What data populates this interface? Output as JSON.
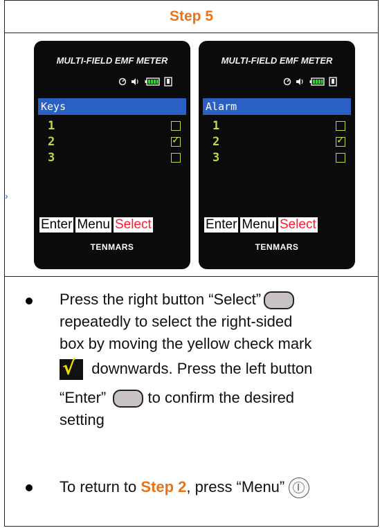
{
  "header": {
    "title": "Step 5"
  },
  "screens": [
    {
      "title": "MULTI-FIELD EMF METER",
      "menu_label": "Keys",
      "items": [
        {
          "label": "1",
          "checked": false
        },
        {
          "label": "2",
          "checked": true
        },
        {
          "label": "3",
          "checked": false
        }
      ],
      "buttons": {
        "enter": "Enter",
        "menu": "Menu",
        "select": "Select"
      },
      "brand": "TENMARS"
    },
    {
      "title": "MULTI-FIELD EMF METER",
      "menu_label": "Alarm",
      "items": [
        {
          "label": "1",
          "checked": false
        },
        {
          "label": "2",
          "checked": true
        },
        {
          "label": "3",
          "checked": false
        }
      ],
      "buttons": {
        "enter": "Enter",
        "menu": "Menu",
        "select": "Select"
      },
      "brand": "TENMARS"
    }
  ],
  "instructions": {
    "p1_part1": "Press the right button “Select”",
    "p1_line2": "repeatedly to select the right-sided",
    "p1_line3": "box by moving the yellow check mark",
    "p1_part4": "downwards. Press the left button",
    "p1_part5a": "“Enter”",
    "p1_part5b": "to confirm the desired",
    "p1_line6": "setting",
    "p2_part1": "To return to ",
    "p2_step": "Step 2",
    "p2_part2": ", press “Menu”"
  },
  "colors": {
    "accent": "#e8731a",
    "menu_bar": "#2a5fc4",
    "item": "#b8e03a",
    "select": "#ff1a2e"
  },
  "icons": [
    "timer-icon",
    "speaker-icon",
    "battery-icon",
    "plug-icon",
    "oval-button-icon",
    "yellow-check-icon",
    "power-button-icon"
  ]
}
